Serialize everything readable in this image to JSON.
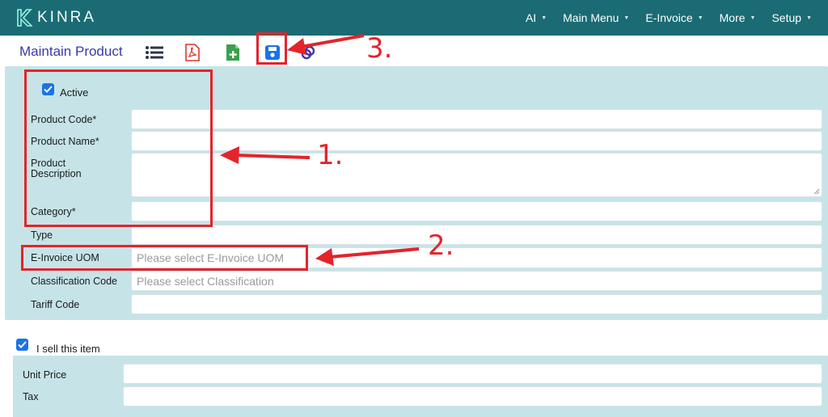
{
  "nav": {
    "logo_text": "KINRA",
    "items": [
      {
        "label": "AI"
      },
      {
        "label": "Main Menu"
      },
      {
        "label": "E-Invoice"
      },
      {
        "label": "More"
      },
      {
        "label": "Setup"
      }
    ]
  },
  "toolbar": {
    "title": "Maintain Product",
    "icons": [
      "list-icon",
      "pdf-icon",
      "add-file-icon",
      "save-icon",
      "link-icon"
    ]
  },
  "form": {
    "active_label": "Active",
    "active_checked": true,
    "fields": {
      "product_code": {
        "label": "Product Code*",
        "value": ""
      },
      "product_name": {
        "label": "Product Name*",
        "value": ""
      },
      "product_description": {
        "label_line1": "Product",
        "label_line2": "Description",
        "value": ""
      },
      "category": {
        "label": "Category*",
        "value": ""
      },
      "type": {
        "label": "Type",
        "value": ""
      },
      "einvoice_uom": {
        "label": "E-Invoice UOM",
        "placeholder": "Please select E-Invoice UOM"
      },
      "classification_code": {
        "label": "Classification Code",
        "placeholder": "Please select Classification"
      },
      "tariff_code": {
        "label": "Tariff Code",
        "value": ""
      }
    }
  },
  "sell": {
    "label": "I sell this item",
    "checked": true,
    "unit_price_label": "Unit Price",
    "tax_label": "Tax"
  },
  "annotations": {
    "one": "1.",
    "two": "2.",
    "three": "3."
  },
  "colors": {
    "nav_bg": "#1a6b73",
    "panel_bg": "#c6e4e8",
    "annotation_red": "#e3242b",
    "title_blue": "#3a3aa8",
    "checkbox_blue": "#1a73e8"
  }
}
